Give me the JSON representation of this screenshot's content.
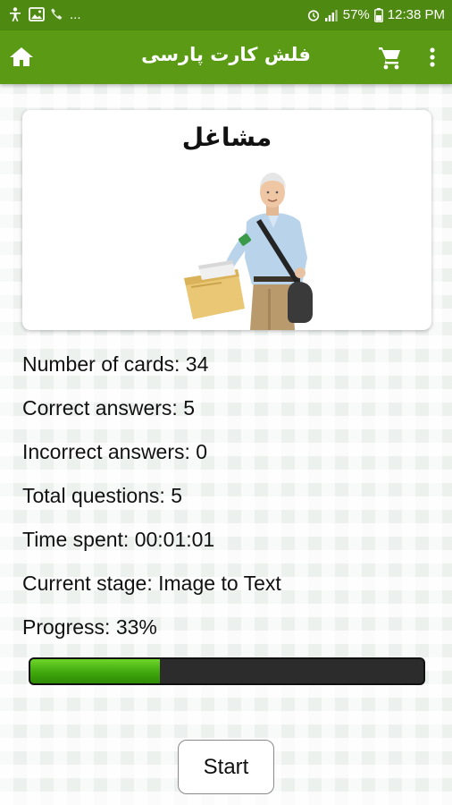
{
  "status_bar": {
    "battery": "57%",
    "time": "12:38 PM",
    "ellipsis": "..."
  },
  "app_bar": {
    "title": "فلش کارت پارسی",
    "color": "#5a9a14"
  },
  "card": {
    "word": "مشاغل",
    "image": "mail-carrier-photo"
  },
  "stats": {
    "number_of_cards": "Number of cards: 34",
    "correct_answers": "Correct answers: 5",
    "incorrect_answers": "Incorrect answers: 0",
    "total_questions": "Total questions: 5",
    "time_spent": "Time spent: 00:01:01",
    "current_stage": "Current stage: Image to Text",
    "progress_label": "Progress: 33%"
  },
  "progress": {
    "value": 0.33,
    "fill_color": "#3fa80d",
    "track_color": "#2c2c2c"
  },
  "actions": {
    "start_label": "Start"
  }
}
